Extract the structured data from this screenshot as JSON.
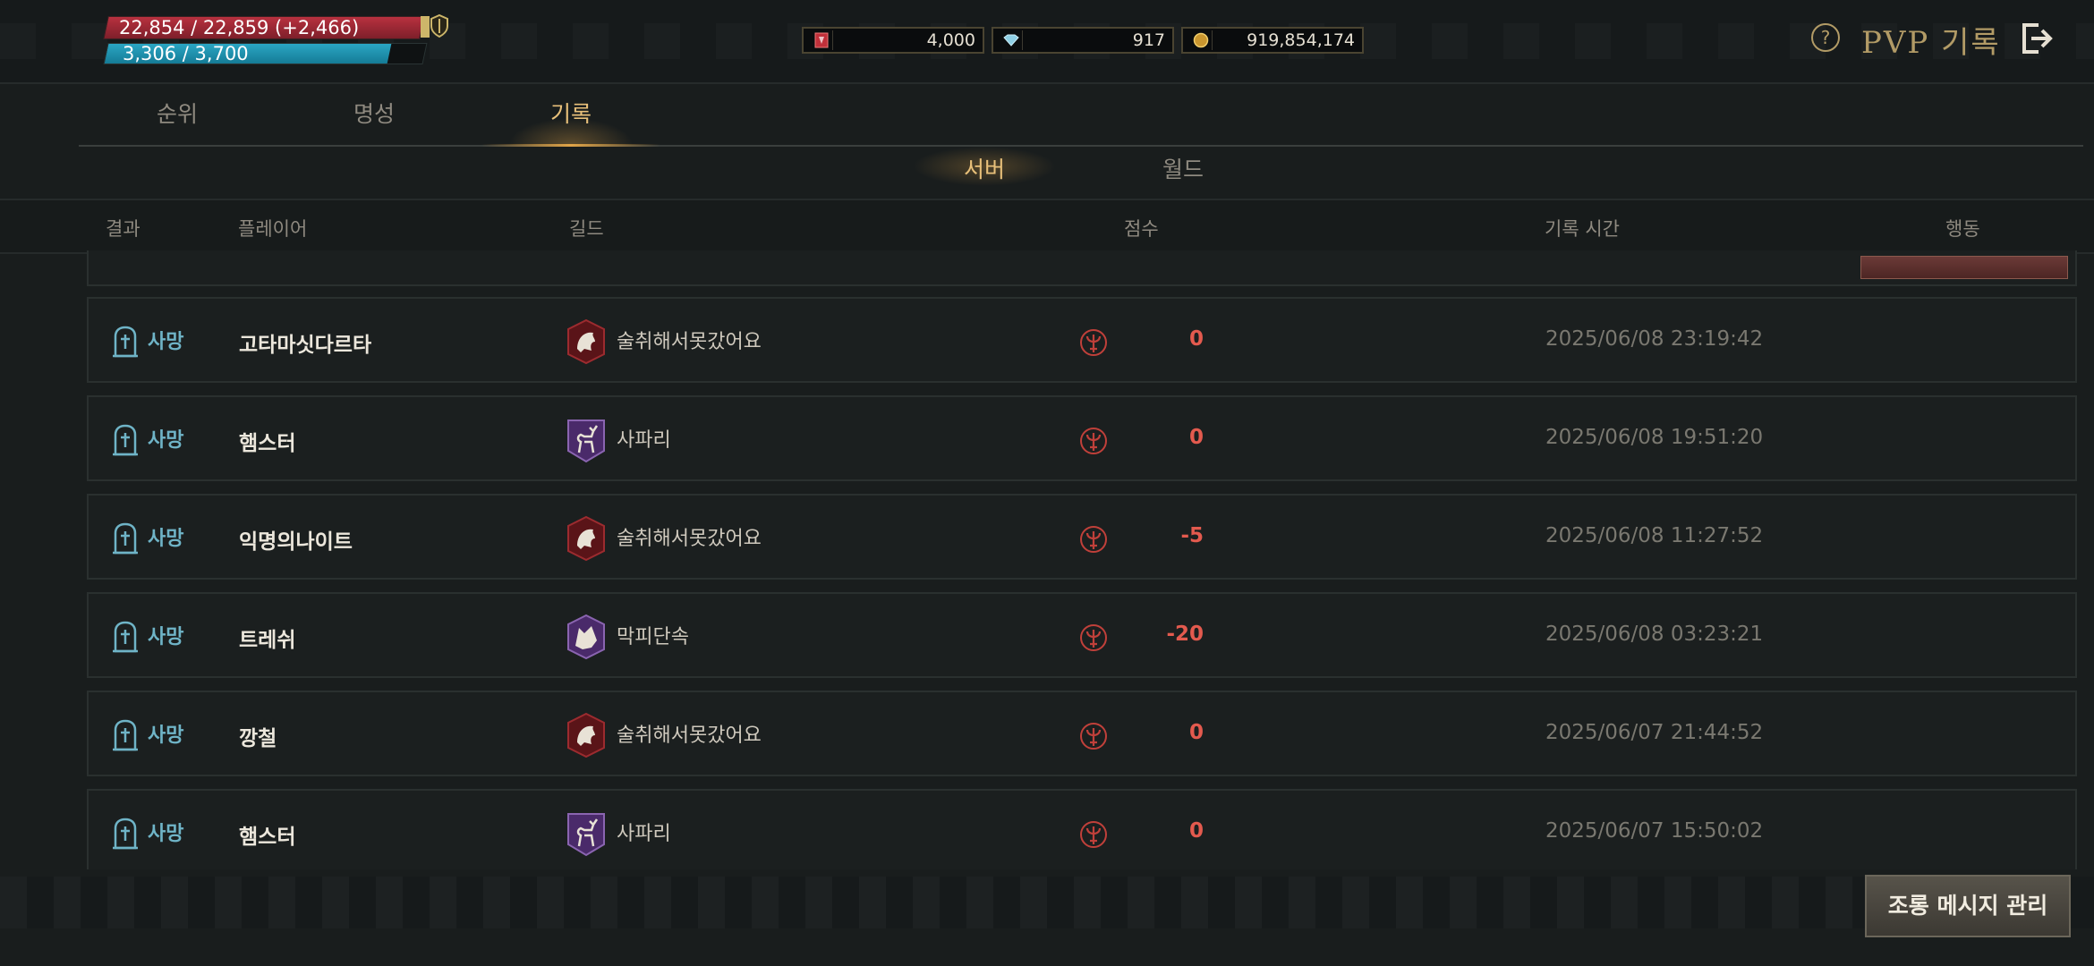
{
  "status": {
    "hp_text": "22,854 / 22,859 (+2,466)",
    "mp_text": "3,306 / 3,700",
    "mp_level": 0.89
  },
  "currencies": [
    {
      "icon": "red-ticket-icon",
      "value": "4,000"
    },
    {
      "icon": "diamond-icon",
      "value": "917"
    },
    {
      "icon": "gold-coin-icon",
      "value": "919,854,174"
    }
  ],
  "header": {
    "title": "PVP 기록",
    "help_icon": "question-circle-icon",
    "exit_icon": "exit-icon"
  },
  "tabs": [
    {
      "label": "순위",
      "active": false
    },
    {
      "label": "명성",
      "active": false
    },
    {
      "label": "기록",
      "active": true
    }
  ],
  "subtabs": [
    {
      "label": "서버",
      "active": true
    },
    {
      "label": "월드",
      "active": false
    }
  ],
  "columns": {
    "result": "결과",
    "player": "플레이어",
    "guild": "길드",
    "score": "점수",
    "time": "기록 시간",
    "action": "행동"
  },
  "rows": [
    {
      "result": "사망",
      "player": "고타마싯다르타",
      "guild": "술취해서못갔어요",
      "emblem": "red-beast-emblem-icon",
      "score": "0",
      "time": "2025/06/08 23:19:42"
    },
    {
      "result": "사망",
      "player": "햄스터",
      "guild": "사파리",
      "emblem": "purple-deer-emblem-icon",
      "score": "0",
      "time": "2025/06/08 19:51:20"
    },
    {
      "result": "사망",
      "player": "익명의나이트",
      "guild": "술취해서못갔어요",
      "emblem": "red-beast-emblem-icon",
      "score": "-5",
      "time": "2025/06/08 11:27:52"
    },
    {
      "result": "사망",
      "player": "트레쉬",
      "guild": "막피단속",
      "emblem": "purple-wolf-emblem-icon",
      "score": "-20",
      "time": "2025/06/08 03:23:21"
    },
    {
      "result": "사망",
      "player": "깡철",
      "guild": "술취해서못갔어요",
      "emblem": "red-beast-emblem-icon",
      "score": "0",
      "time": "2025/06/07 21:44:52"
    },
    {
      "result": "사망",
      "player": "햄스터",
      "guild": "사파리",
      "emblem": "purple-deer-emblem-icon",
      "score": "0",
      "time": "2025/06/07 15:50:02"
    }
  ],
  "footer": {
    "taunt_button": "조롱 메시지 관리"
  },
  "colors": {
    "accent": "#e8c07a",
    "result": "#6fb4c7",
    "score_negative": "#e35a4e",
    "hp": "#b8313f",
    "mp": "#2aa6c4"
  }
}
